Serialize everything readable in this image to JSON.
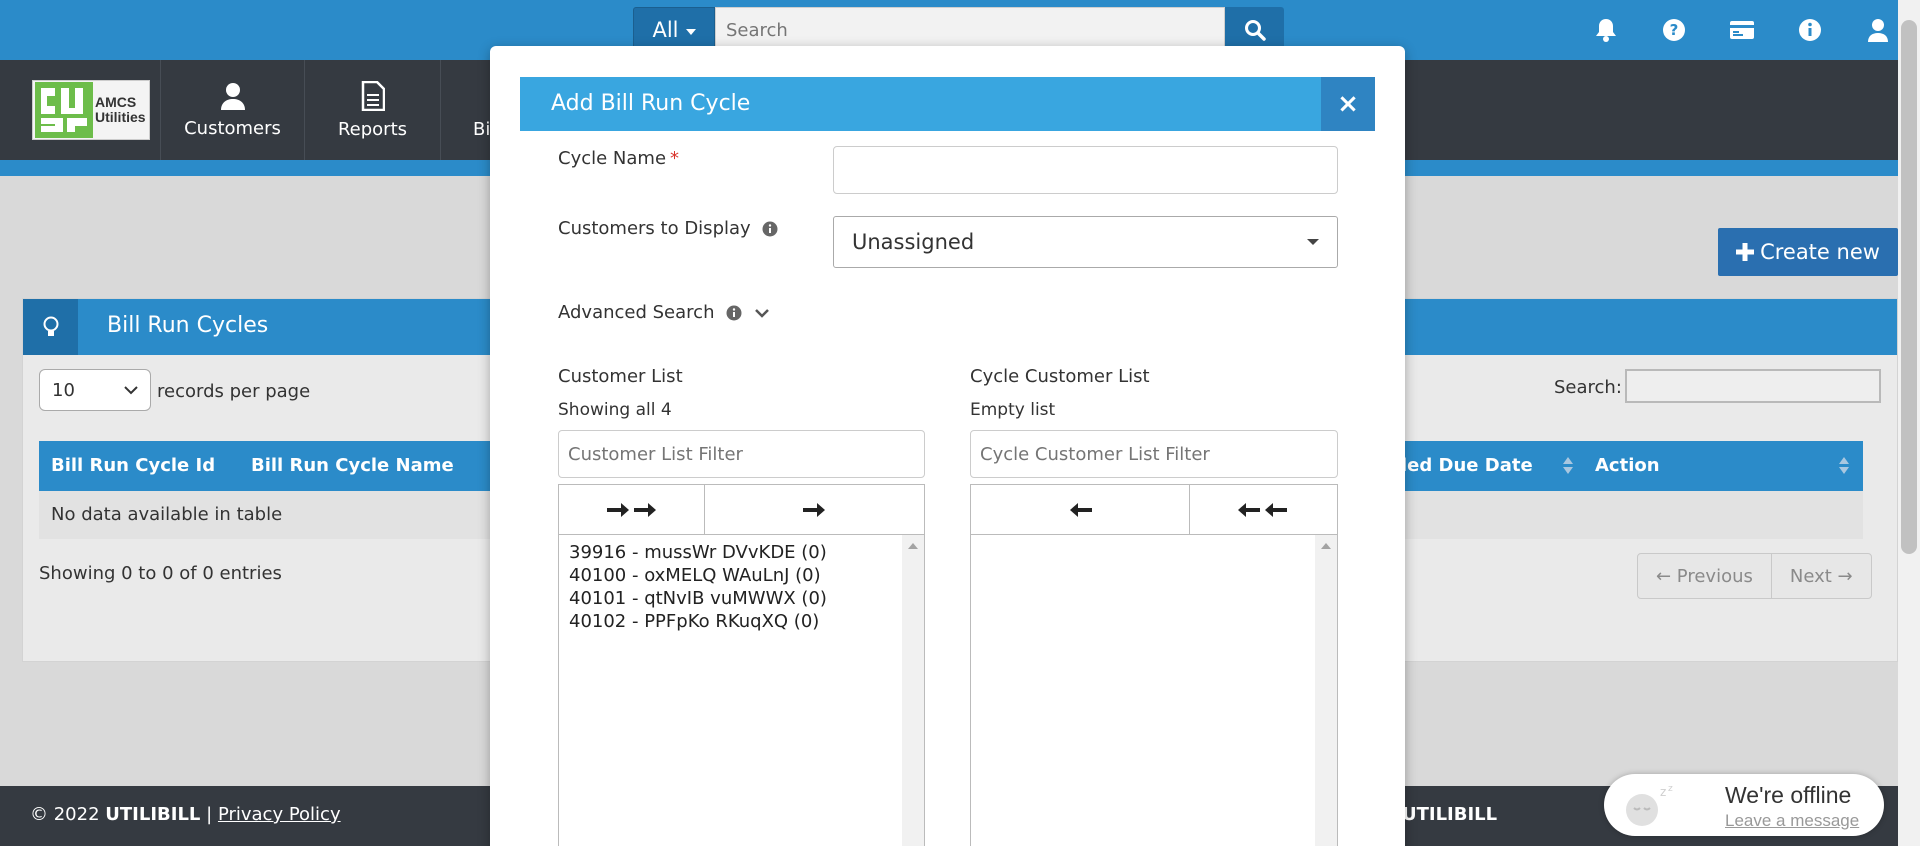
{
  "header": {
    "search_scope": "All",
    "search_placeholder": "Search",
    "icons": [
      "search-icon",
      "bell-icon",
      "help-icon",
      "card-icon",
      "info-icon",
      "user-icon"
    ]
  },
  "brand": {
    "logo_text_line1": "AMCS",
    "logo_text_line2": "Utilities"
  },
  "nav": {
    "items": [
      {
        "label": "Customers",
        "icon": "user-icon"
      },
      {
        "label": "Reports",
        "icon": "document-icon"
      },
      {
        "label": "Bi",
        "icon": "billing-icon"
      }
    ]
  },
  "page": {
    "create_button": "Create new",
    "panel_title": "Bill Run Cycles",
    "records_per_page_value": "10",
    "records_per_page_label": "records per page",
    "search_label": "Search:",
    "columns": [
      "Bill Run Cycle Id",
      "Bill Run Cycle Name",
      "led Due Date",
      "Action"
    ],
    "empty_message": "No data available in table",
    "showing_text": "Showing 0 to 0 of 0 entries",
    "prev_label": "← Previous",
    "next_label": "Next →"
  },
  "modal": {
    "title": "Add Bill Run Cycle",
    "close_label": "×",
    "cycle_name_label": "Cycle Name",
    "required_mark": "*",
    "cycle_name_value": "",
    "customers_to_display_label": "Customers to Display",
    "customers_to_display_value": "Unassigned",
    "advanced_search_label": "Advanced Search",
    "customer_list": {
      "title": "Customer List",
      "count_text": "Showing all 4",
      "filter_placeholder": "Customer List Filter",
      "items": [
        "39916 - mussWr DVvKDE (0)",
        "40100 - oxMELQ WAuLnJ (0)",
        "40101 - qtNvIB vuMWWX (0)",
        "40102 - PPFpKo RKuqXQ (0)"
      ]
    },
    "cycle_customer_list": {
      "title": "Cycle Customer List",
      "count_text": "Empty list",
      "filter_placeholder": "Cycle Customer List Filter"
    }
  },
  "footer": {
    "copyright": "© 2022",
    "brand": "UTILIBILL",
    "separator": "|",
    "privacy_link": "Privacy Policy",
    "right_brand": "UTILIBILL"
  },
  "chat": {
    "status": "We're offline",
    "action": "Leave a message"
  },
  "colors": {
    "primary_blue": "#2b8bc9",
    "modal_header_blue": "#39a6e0",
    "dark_nav": "#353a41",
    "button_blue": "#2a6fb0"
  }
}
